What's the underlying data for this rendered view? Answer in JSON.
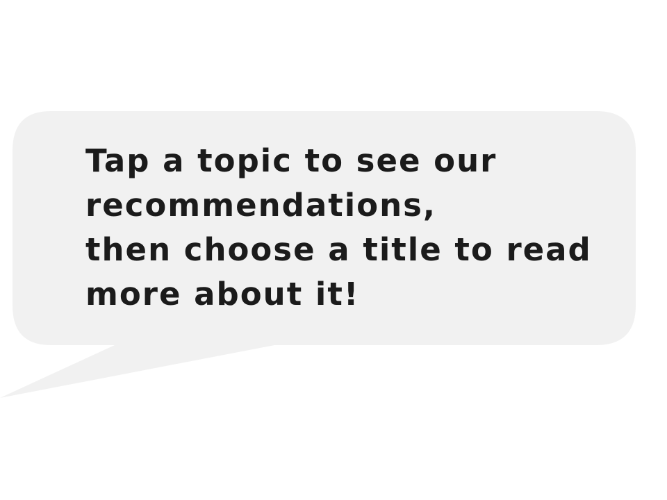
{
  "colors": {
    "page_background": "#ffffff",
    "bubble_fill": "#f1f1f1",
    "text": "#1b1b1b"
  },
  "speech_bubble": {
    "lines": [
      "Tap a topic to see our",
      "recommendations,",
      "then choose a title to read",
      "more about it!"
    ]
  }
}
